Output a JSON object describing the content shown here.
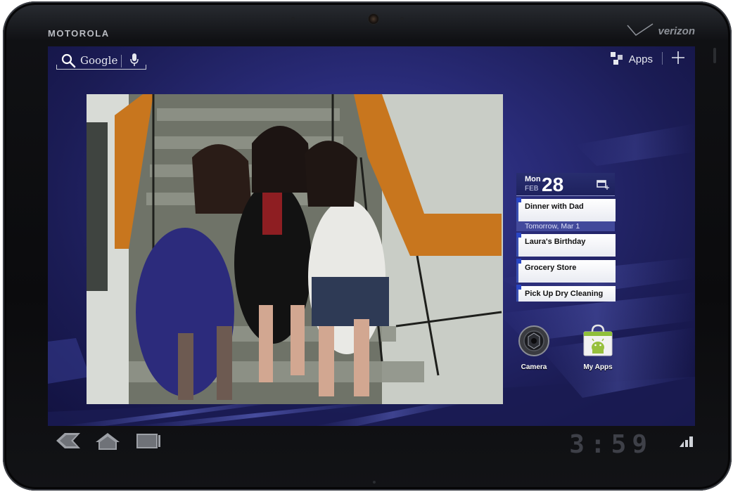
{
  "device": {
    "brand": "MOTOROLA",
    "carrier": "verizon"
  },
  "search": {
    "label": "Google"
  },
  "top_bar": {
    "apps_label": "Apps"
  },
  "calendar": {
    "day_of_week": "Mon",
    "month": "FEB",
    "day": "28",
    "events_today": [
      "Dinner with Dad"
    ],
    "divider": "Tomorrow, Mar 1",
    "events_tomorrow": [
      "Laura's Birthday",
      "Grocery Store",
      "Pick Up Dry Cleaning"
    ]
  },
  "shortcuts": [
    {
      "label": "Camera",
      "icon": "camera-icon"
    },
    {
      "label": "My Apps",
      "icon": "market-bag-icon"
    }
  ],
  "system_bar": {
    "time": "3:59",
    "icons": [
      "back-icon",
      "home-icon",
      "recent-apps-icon",
      "signal-icon"
    ]
  },
  "colors": {
    "wallpaper": "#2a2c7a",
    "accent": "#2a46c4"
  }
}
